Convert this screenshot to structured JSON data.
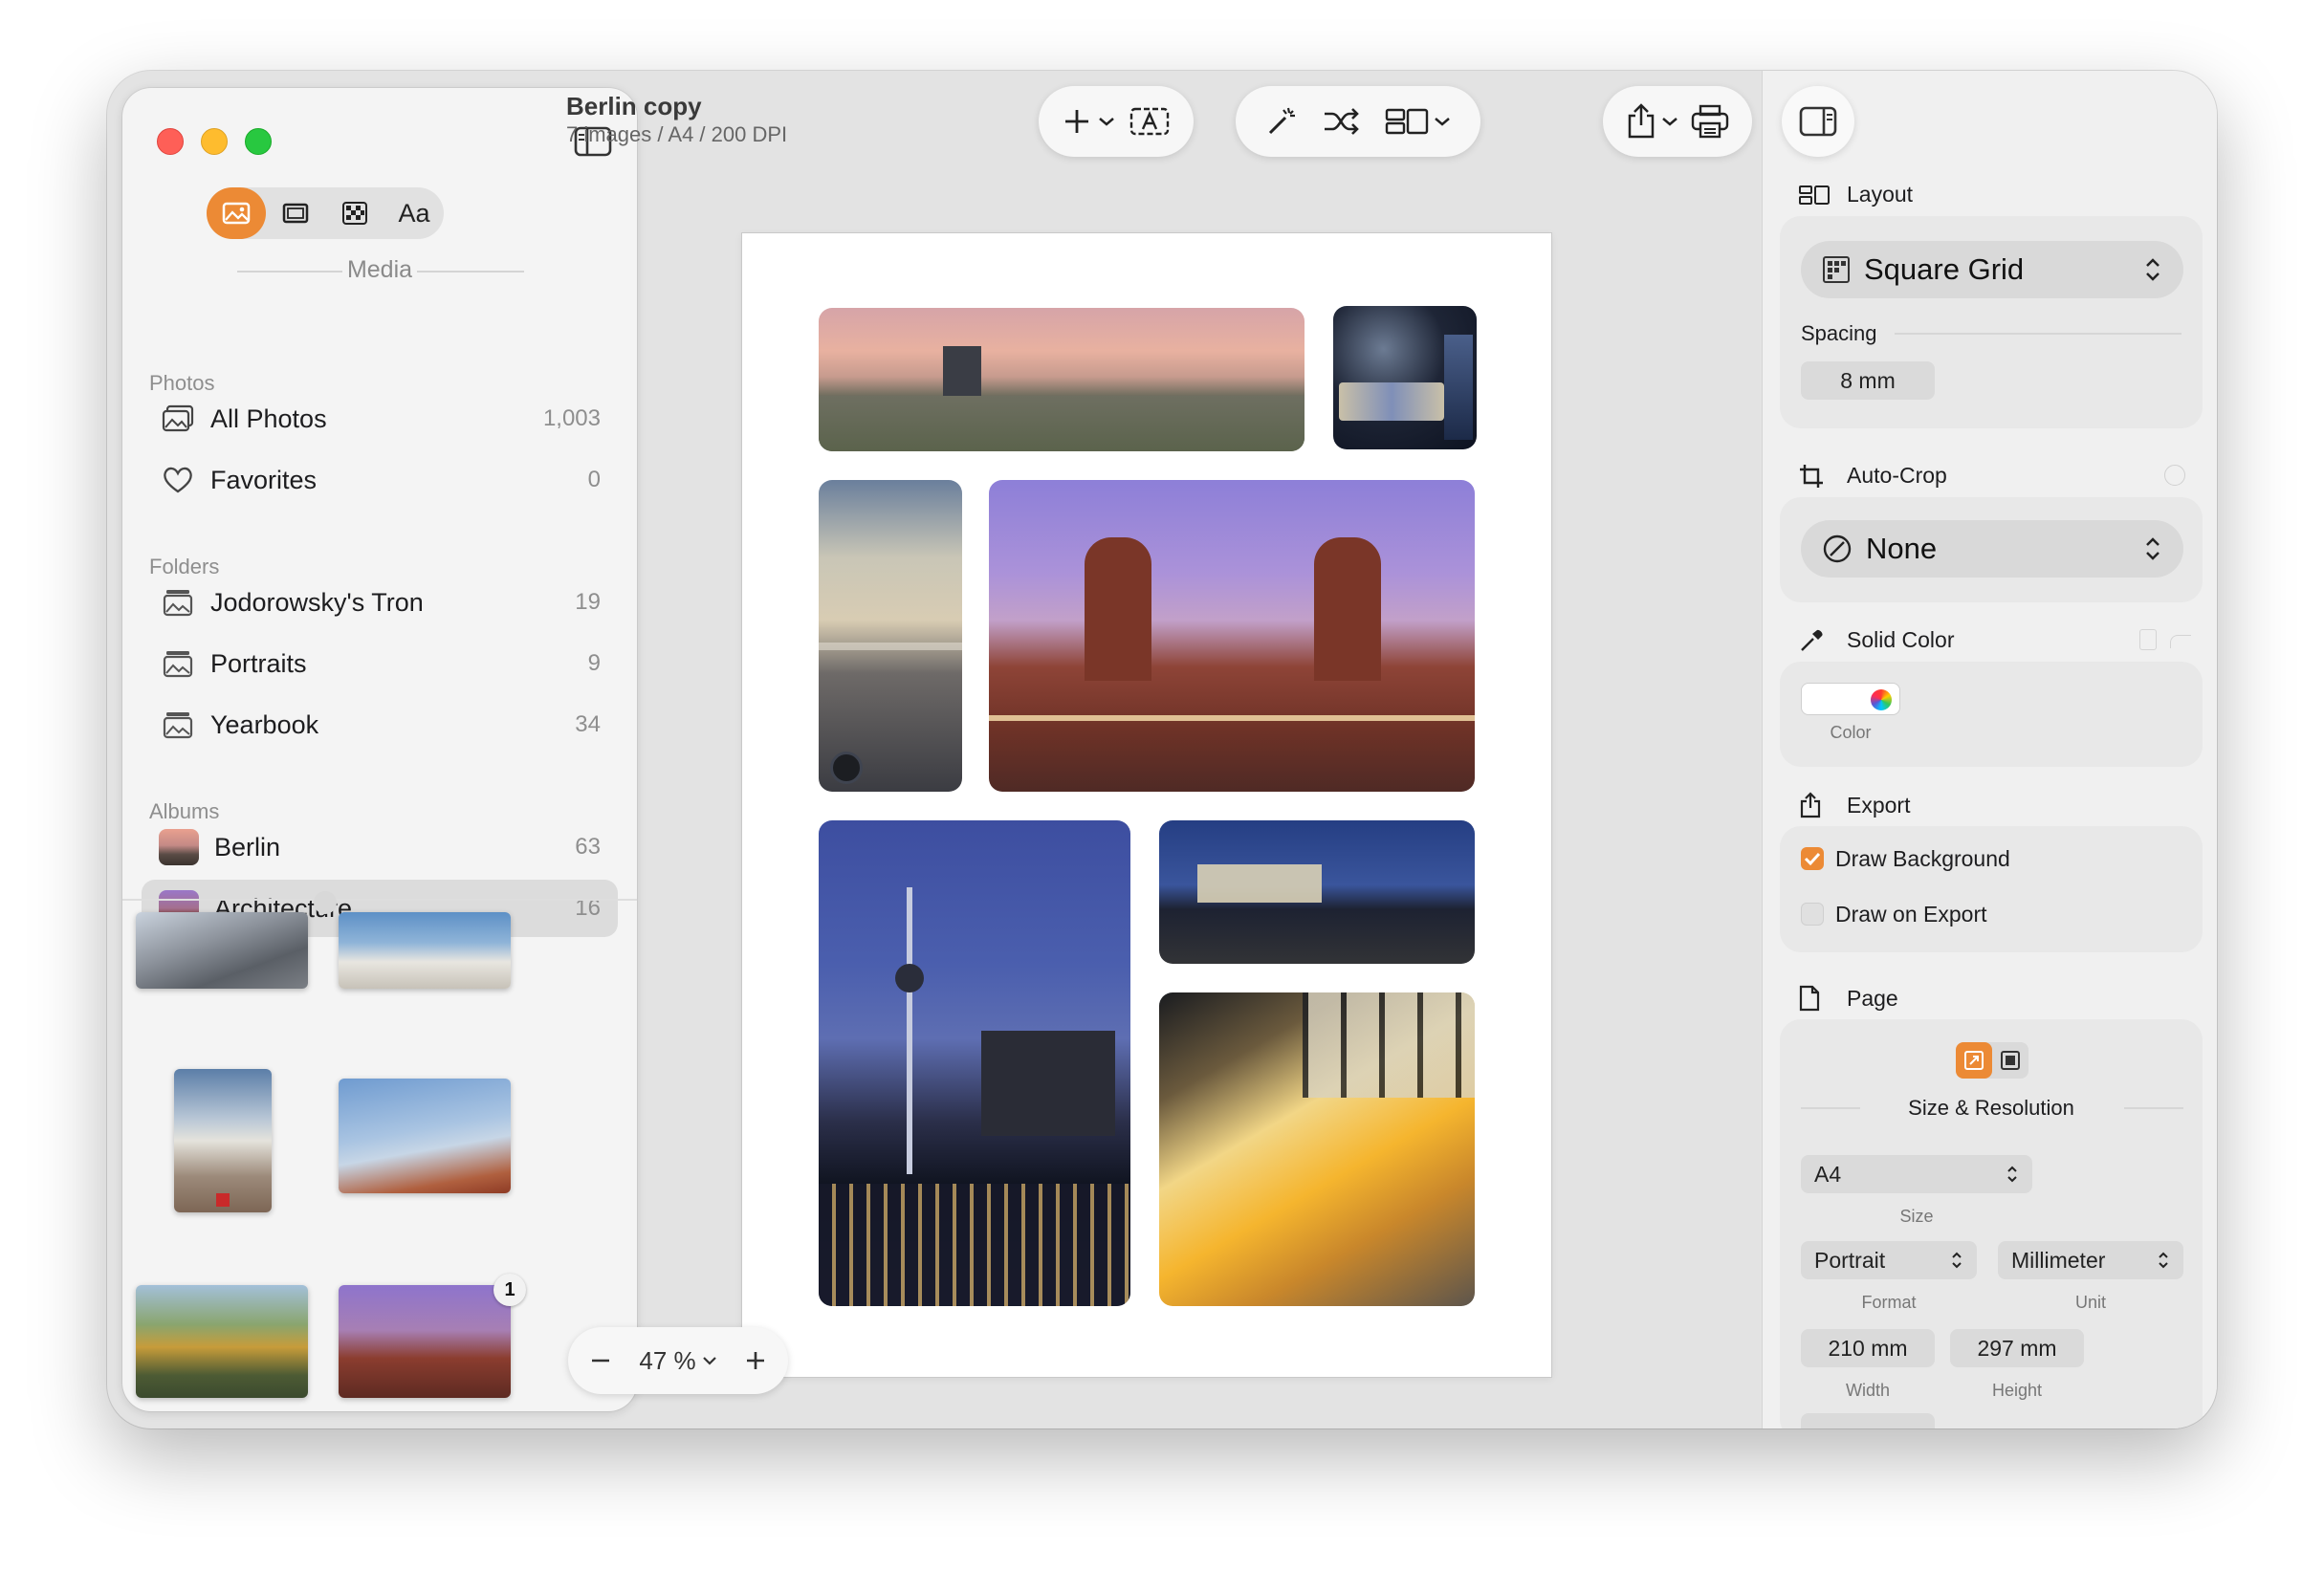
{
  "sidebar": {
    "seg_text_label": "Aa",
    "media_label": "Media",
    "groups": {
      "photos": "Photos",
      "folders": "Folders",
      "albums": "Albums"
    },
    "photos": [
      {
        "label": "All Photos",
        "count": "1,003",
        "icon": "photo-stack-icon"
      },
      {
        "label": "Favorites",
        "count": "0",
        "icon": "heart-icon"
      }
    ],
    "folders": [
      {
        "label": "Jodorowsky's Tron",
        "count": "19"
      },
      {
        "label": "Portraits",
        "count": "9"
      },
      {
        "label": "Yearbook",
        "count": "34"
      }
    ],
    "albums": [
      {
        "label": "Berlin",
        "count": "63"
      },
      {
        "label": "Architecture",
        "count": "16",
        "selected": true
      }
    ],
    "thumb_badge": "1"
  },
  "document": {
    "title": "Berlin copy",
    "subtitle": "7 images / A4 / 200 DPI"
  },
  "zoom": {
    "value": "47 %"
  },
  "inspector": {
    "layout": {
      "header": "Layout",
      "value": "Square Grid",
      "spacing_label": "Spacing",
      "spacing_value": "8 mm"
    },
    "autocrop": {
      "header": "Auto-Crop",
      "value": "None"
    },
    "solid_color": {
      "header": "Solid Color",
      "color_caption": "Color"
    },
    "export": {
      "header": "Export",
      "draw_background": "Draw Background",
      "draw_on_export": "Draw on Export"
    },
    "page": {
      "header": "Page",
      "size_resolution": "Size & Resolution",
      "size_value": "A4",
      "size_caption": "Size",
      "format_value": "Portrait",
      "format_caption": "Format",
      "unit_value": "Millimeter",
      "unit_caption": "Unit",
      "width_value": "210 mm",
      "width_caption": "Width",
      "height_value": "297 mm",
      "height_caption": "Height"
    }
  },
  "colors": {
    "accent": "#ec8a35",
    "window_bg": "#e3e3e3",
    "sidebar_bg": "#f4f4f4"
  }
}
